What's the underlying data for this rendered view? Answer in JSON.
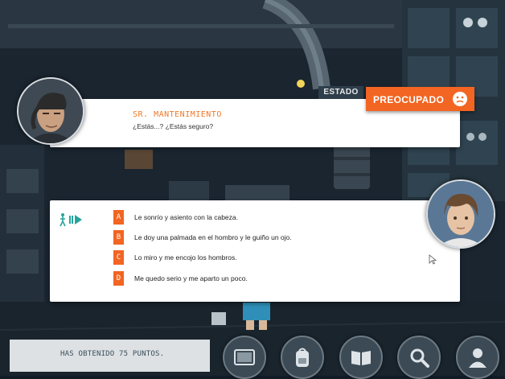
{
  "dialogue": {
    "speaker": "SR. MANTENIMIENTO",
    "line": "¿Estás...? ¿Estás seguro?"
  },
  "estado": {
    "label": "ESTADO",
    "value": "PREOCUPADO",
    "icon": "worried-face-icon"
  },
  "choices": [
    {
      "letter": "A",
      "text": "Le sonrío y asiento con la cabeza."
    },
    {
      "letter": "B",
      "text": "Le doy una palmada en el hombro y le guiño un ojo."
    },
    {
      "letter": "C",
      "text": "Lo miro y me encojo los hombros."
    },
    {
      "letter": "D",
      "text": "Me quedo serio y me aparto un poco."
    }
  ],
  "score": {
    "text": "HAS OBTENIDO 75 PUNTOS."
  },
  "menu": [
    {
      "name": "tablet-button",
      "icon": "tablet-icon"
    },
    {
      "name": "backpack-button",
      "icon": "backpack-icon"
    },
    {
      "name": "book-button",
      "icon": "book-icon"
    },
    {
      "name": "search-button",
      "icon": "search-icon"
    },
    {
      "name": "profile-button",
      "icon": "user-icon"
    }
  ],
  "colors": {
    "accent": "#f26522",
    "speaker": "#ee7a2a",
    "estado_label_bg": "#2e3e4a",
    "score_bg": "#dde1e3",
    "scene_bg": "#121c26"
  }
}
